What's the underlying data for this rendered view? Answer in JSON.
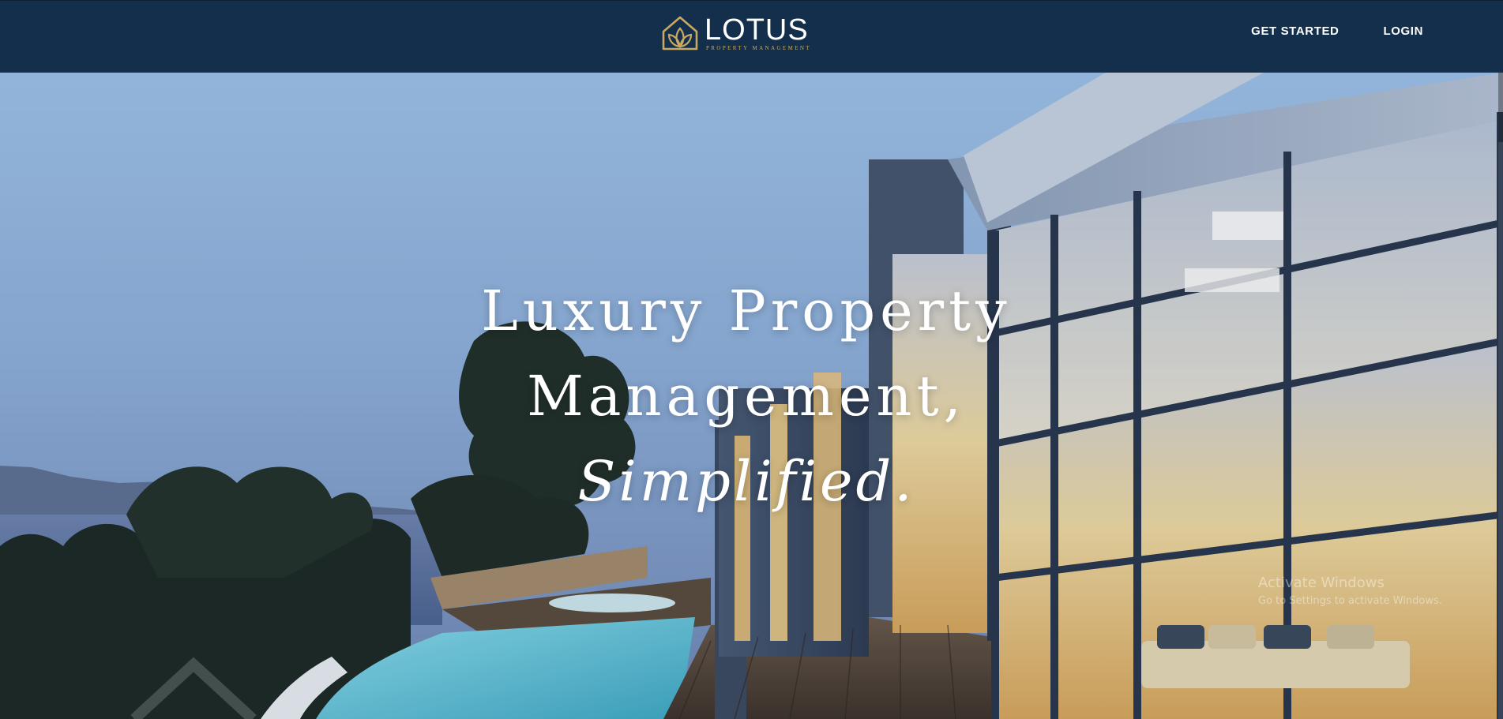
{
  "header": {
    "brand": {
      "name": "LOTUS",
      "tagline": "PROPERTY MANAGEMENT",
      "logo_icon": "lotus-house-icon"
    },
    "nav": [
      {
        "label": "GET STARTED"
      },
      {
        "label": "LOGIN"
      }
    ]
  },
  "hero": {
    "headline_line1": "Luxury Property",
    "headline_line2": "Management,",
    "headline_line3": "Simplified.",
    "image": "modern-glass-villa-with-infinity-pool-at-dusk"
  },
  "system_overlay": {
    "watermark_title": "Activate Windows",
    "watermark_sub": "Go to Settings to activate Windows."
  },
  "colors": {
    "nav_background": "#132f4b",
    "brand_gold": "#c9a862",
    "text_white": "#ffffff"
  }
}
